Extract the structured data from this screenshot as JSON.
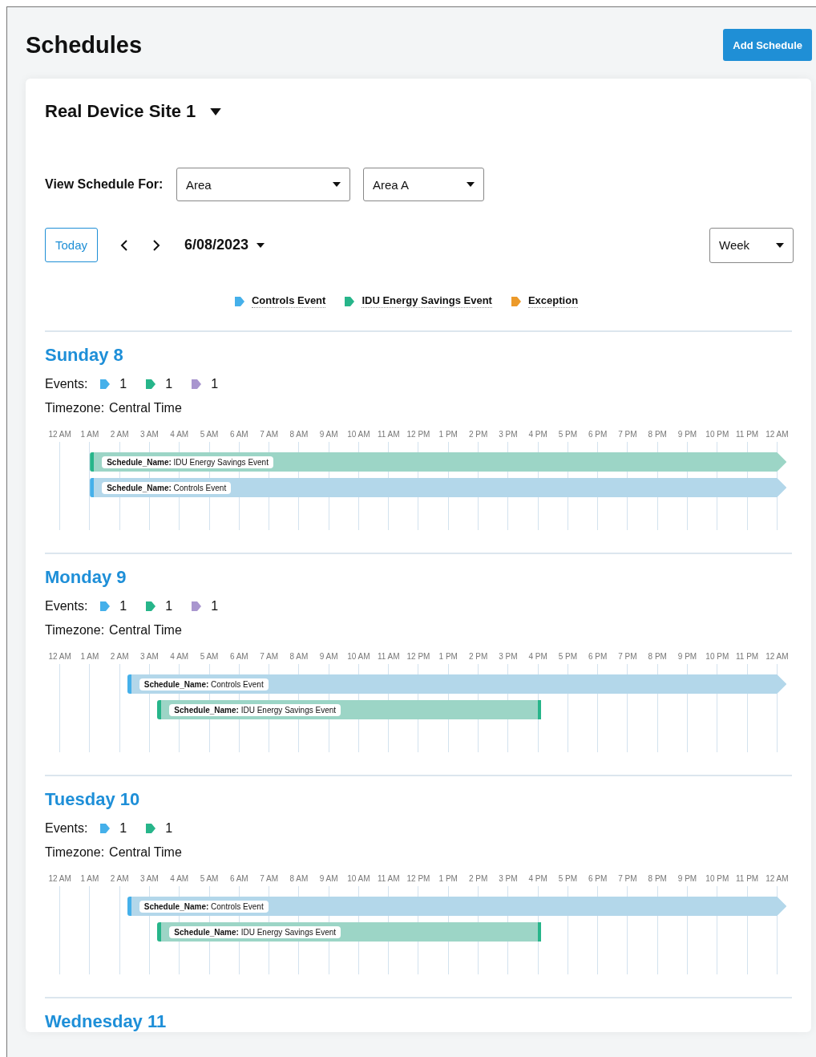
{
  "page": {
    "title": "Schedules",
    "add_button": "Add Schedule"
  },
  "site": {
    "name": "Real Device Site 1"
  },
  "filters": {
    "label": "View Schedule For:",
    "selects": [
      {
        "value": "Area"
      },
      {
        "value": "Area A"
      }
    ]
  },
  "navigation": {
    "today": "Today",
    "date": "6/08/2023",
    "view": "Week"
  },
  "legend": [
    {
      "label": "Controls Event",
      "color": "#45b0ea"
    },
    {
      "label": "IDU Energy Savings Event",
      "color": "#27b58a"
    },
    {
      "label": "Exception",
      "color": "#ec9a2a"
    }
  ],
  "days": [
    {
      "heading": "Sunday 8",
      "events_label": "Events:",
      "counts": [
        {
          "count": "1",
          "color": "#45b0ea"
        },
        {
          "count": "1",
          "color": "#27b58a"
        },
        {
          "count": "1",
          "color": "#a996cf"
        }
      ],
      "timezone_label": "Timezone:",
      "timezone": "Central Time",
      "hours": [
        "12 AM",
        "1 AM",
        "2 AM",
        "3 AM",
        "4 AM",
        "5 AM",
        "6 AM",
        "7 AM",
        "8 AM",
        "9 AM",
        "10 AM",
        "11 AM",
        "12 PM",
        "1 PM",
        "2 PM",
        "3 PM",
        "4 PM",
        "5 PM",
        "6 PM",
        "7 PM",
        "8 PM",
        "9 PM",
        "10 PM",
        "11 PM",
        "12 AM"
      ],
      "bars": [
        {
          "kind": "idu",
          "label": "**Schedule_Name:** IDU Energy Savings Event",
          "continues": true
        },
        {
          "kind": "controls",
          "label": "**Schedule_Name:** Controls Event",
          "continues": true
        }
      ]
    },
    {
      "heading": "Monday 9",
      "events_label": "Events:",
      "counts": [
        {
          "count": "1",
          "color": "#45b0ea"
        },
        {
          "count": "1",
          "color": "#27b58a"
        },
        {
          "count": "1",
          "color": "#a996cf"
        }
      ],
      "timezone_label": "Timezone:",
      "timezone": "Central Time",
      "hours": [
        "12 AM",
        "1 AM",
        "2 AM",
        "3 AM",
        "4 AM",
        "5 AM",
        "6 AM",
        "7 AM",
        "8 AM",
        "9 AM",
        "10 AM",
        "11 AM",
        "12 PM",
        "1 PM",
        "2 PM",
        "3 PM",
        "4 PM",
        "5 PM",
        "6 PM",
        "7 PM",
        "8 PM",
        "9 PM",
        "10 PM",
        "11 PM",
        "12 AM"
      ],
      "bars": [
        {
          "kind": "controls",
          "label": "**Schedule_Name:** Controls Event",
          "continues": true
        },
        {
          "kind": "idu",
          "label": "**Schedule_Name:** IDU Energy Savings Event",
          "continues": false
        }
      ]
    },
    {
      "heading": "Tuesday 10",
      "events_label": "Events:",
      "counts": [
        {
          "count": "1",
          "color": "#45b0ea"
        },
        {
          "count": "1",
          "color": "#27b58a"
        }
      ],
      "timezone_label": "Timezone:",
      "timezone": "Central Time",
      "hours": [
        "12 AM",
        "1 AM",
        "2 AM",
        "3 AM",
        "4 AM",
        "5 AM",
        "6 AM",
        "7 AM",
        "8 AM",
        "9 AM",
        "10 AM",
        "11 AM",
        "12 PM",
        "1 PM",
        "2 PM",
        "3 PM",
        "4 PM",
        "5 PM",
        "6 PM",
        "7 PM",
        "8 PM",
        "9 PM",
        "10 PM",
        "11 PM",
        "12 AM"
      ],
      "bars": [
        {
          "kind": "controls",
          "label": "**Schedule_Name:** Controls Event",
          "continues": true
        },
        {
          "kind": "idu",
          "label": "**Schedule_Name:** IDU Energy Savings Event",
          "continues": false
        }
      ]
    },
    {
      "heading": "Wednesday 11"
    }
  ]
}
